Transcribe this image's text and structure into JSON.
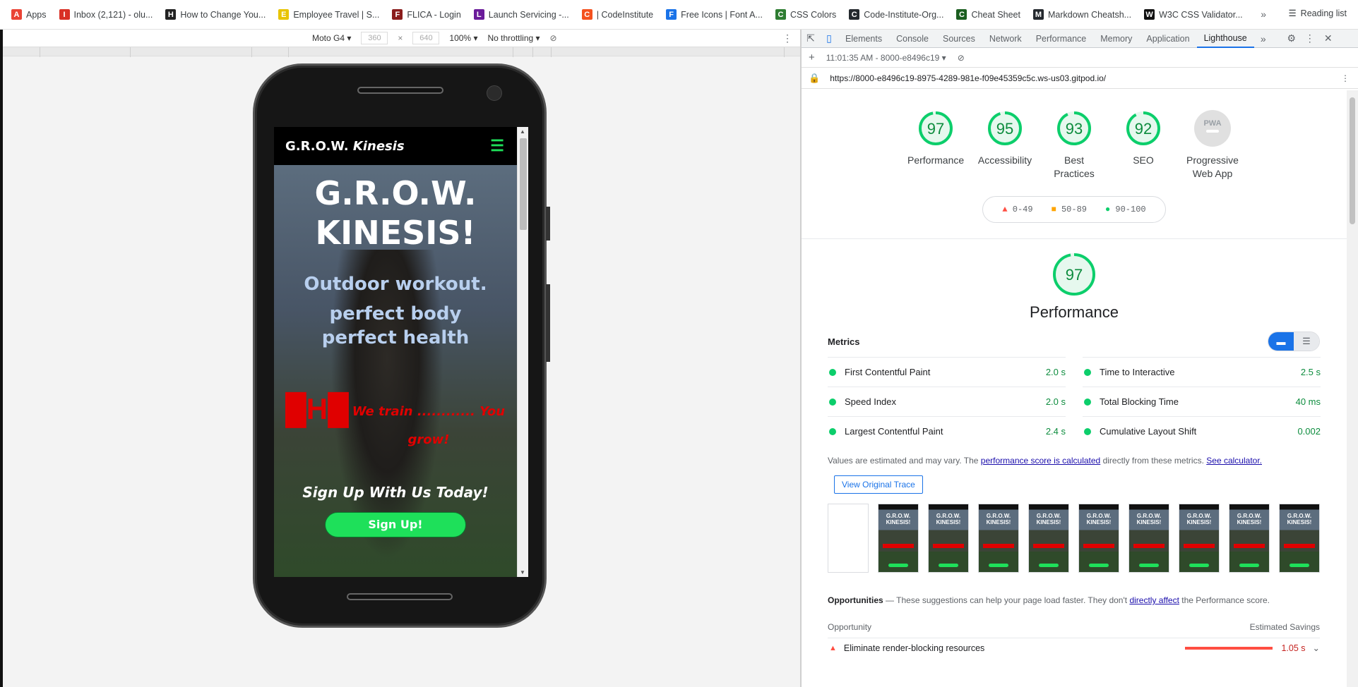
{
  "bookmarks": {
    "items": [
      {
        "label": "Apps",
        "icon": "apps-grid-icon",
        "color": "#ea4335"
      },
      {
        "label": "Inbox (2,121) - olu...",
        "icon": "gmail-icon",
        "color": "#d93025"
      },
      {
        "label": "How to Change You...",
        "icon": "b-icon",
        "color": "#222222"
      },
      {
        "label": "Employee Travel | S...",
        "icon": "s-icon",
        "color": "#e8c400"
      },
      {
        "label": "FLICA - Login",
        "icon": "flica-icon",
        "color": "#8a1c1c"
      },
      {
        "label": "Launch Servicing -...",
        "icon": "l-icon",
        "color": "#6a1b9a"
      },
      {
        "label": "| CodeInstitute",
        "icon": "codeinstitute-icon",
        "color": "#f4511e"
      },
      {
        "label": "Free Icons | Font A...",
        "icon": "fontawesome-icon",
        "color": "#1a73e8"
      },
      {
        "label": "CSS Colors",
        "icon": "w3schools-icon",
        "color": "#2e7d32"
      },
      {
        "label": "Code-Institute-Org...",
        "icon": "github-icon",
        "color": "#24292e"
      },
      {
        "label": "Cheat Sheet",
        "icon": "cheatsheet-icon",
        "color": "#1b5e20"
      },
      {
        "label": "Markdown Cheatsh...",
        "icon": "github-icon",
        "color": "#24292e"
      },
      {
        "label": "W3C CSS Validator...",
        "icon": "w3c-icon",
        "color": "#111111"
      }
    ],
    "more": "»",
    "reading_list": "Reading list"
  },
  "emulator": {
    "device": "Moto G4",
    "width": "360",
    "times": "×",
    "height": "640",
    "zoom": "100%",
    "throttling": "No throttling"
  },
  "site": {
    "brand": "G.R.O.W.",
    "brand_em": "Kinesis",
    "hero_line1": "G.R.O.W.",
    "hero_line2": "KINESIS!",
    "tag1": "Outdoor workout.",
    "tag2a": "perfect body",
    "tag2b": "perfect health",
    "train_text": "We train ............ You grow!",
    "signup_text": "Sign Up With Us Today!",
    "signup_button": "Sign Up!"
  },
  "devtools": {
    "tabs": [
      "Elements",
      "Console",
      "Sources",
      "Network",
      "Performance",
      "Memory",
      "Application",
      "Lighthouse"
    ],
    "active_tab": "Lighthouse",
    "report_time": "11:01:35 AM - 8000-e8496c19",
    "url": "https://8000-e8496c19-8975-4289-981e-f09e45359c5c.ws-us03.gitpod.io/"
  },
  "lighthouse": {
    "scores": [
      {
        "label": "Performance",
        "value": "97",
        "score": 0.97
      },
      {
        "label": "Accessibility",
        "value": "95",
        "score": 0.95
      },
      {
        "label": "Best Practices",
        "value": "93",
        "score": 0.93
      },
      {
        "label": "SEO",
        "value": "92",
        "score": 0.92
      }
    ],
    "pwa": {
      "label": "Progressive Web App",
      "badge": "PWA"
    },
    "legend": {
      "fail": "0-49",
      "average": "50-89",
      "pass": "90-100"
    },
    "perf_score": "97",
    "perf_title": "Performance",
    "metrics_label": "Metrics",
    "metrics": [
      {
        "name": "First Contentful Paint",
        "value": "2.0 s"
      },
      {
        "name": "Time to Interactive",
        "value": "2.5 s"
      },
      {
        "name": "Speed Index",
        "value": "2.0 s"
      },
      {
        "name": "Total Blocking Time",
        "value": "40 ms"
      },
      {
        "name": "Largest Contentful Paint",
        "value": "2.4 s"
      },
      {
        "name": "Cumulative Layout Shift",
        "value": "0.002"
      }
    ],
    "note_prefix": "Values are estimated and may vary. The",
    "note_link1": "performance score is calculated",
    "note_middle": "directly from these metrics.",
    "note_link2": "See calculator.",
    "trace_button": "View Original Trace",
    "film_title": "G.R.O.W. KINESIS!",
    "opps_title": "Opportunities",
    "opps_dash": "—",
    "opps_text": "These suggestions can help your page load faster. They don't",
    "opps_link": "directly affect",
    "opps_tail": "the Performance score.",
    "opp_col1": "Opportunity",
    "opp_col2": "Estimated Savings",
    "opp_row": {
      "name": "Eliminate render-blocking resources",
      "value": "1.05 s"
    }
  }
}
